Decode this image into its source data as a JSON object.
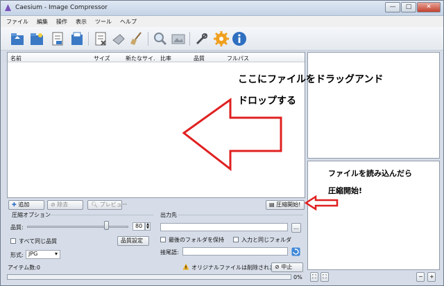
{
  "window": {
    "title": "Caesium - Image Compressor",
    "minimize": "—",
    "maximize": "□",
    "close": "✕"
  },
  "menu": [
    "ファイル",
    "編集",
    "操作",
    "表示",
    "ツール",
    "ヘルプ"
  ],
  "toolbar_icons": [
    "open-file-icon",
    "open-folder-icon",
    "save-list-icon",
    "save-icon",
    "remove-list-icon",
    "clear-icon",
    "broom-icon",
    "magnifier-icon",
    "preview-icon",
    "tools-icon",
    "settings-gear-icon",
    "info-icon"
  ],
  "list": {
    "columns": [
      "名前",
      "サイズ",
      "新たなサイ.",
      "比率",
      "品質",
      "フルパス"
    ]
  },
  "actions": {
    "add": "追加",
    "remove": "除去",
    "preview": "プレビュー",
    "start": "圧縮開始!"
  },
  "options": {
    "section": "圧縮オプション",
    "quality_label": "品質:",
    "quality_value": "80",
    "quality_level": 0.8,
    "same_quality": "すべて同じ品質",
    "quality_settings": "品質設定",
    "format_label": "形式:",
    "format_value": "JPG"
  },
  "output": {
    "section": "出力先",
    "path_value": "",
    "browse": "...",
    "keep_structure": "最後のフォルダを保持",
    "same_as_input": "入力と同じフォルダ",
    "suffix_label": "接尾語:"
  },
  "status": {
    "item_count": "アイテム数:0",
    "warning": "オリジナルファイルは削除されます!",
    "stop": "中止",
    "progress": "0%"
  },
  "annotations": {
    "drop_line1": "ここにファイルをドラッグアンド",
    "drop_line2": "ドロップする",
    "start_line1": "ファイルを読み込んだら",
    "start_line2": "圧縮開始!"
  },
  "colors": {
    "arrow": "#e02020",
    "accent": "#2f6fc0"
  }
}
